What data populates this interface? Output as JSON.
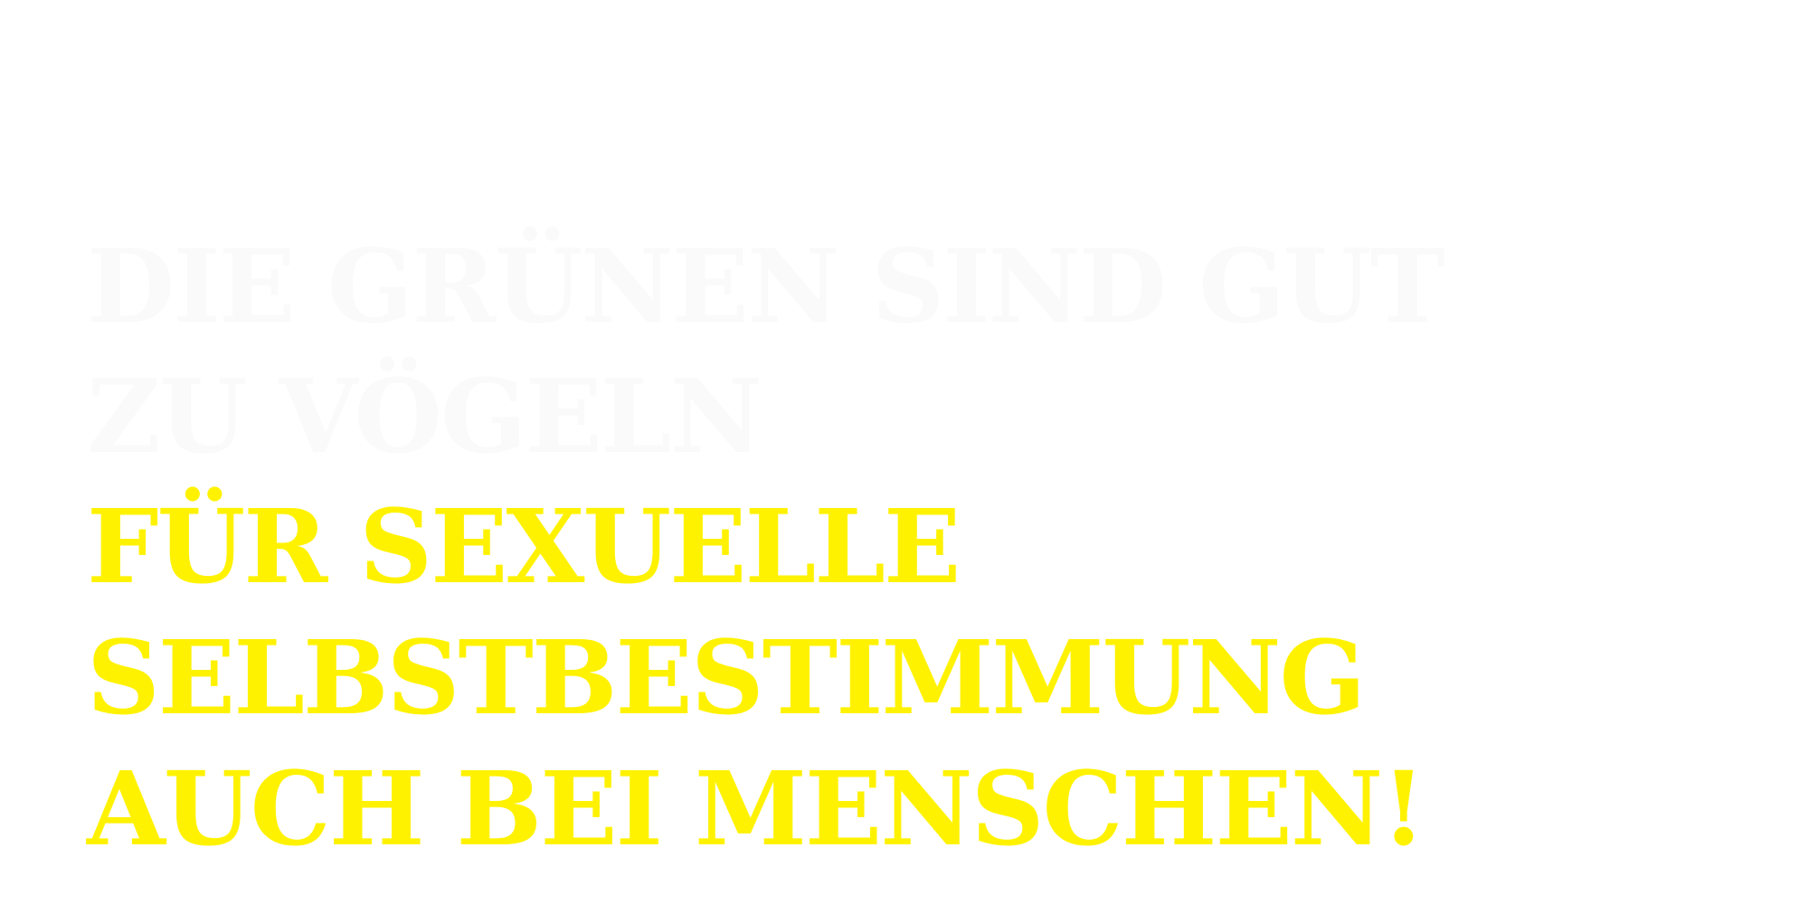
{
  "headline": {
    "ghost_lines": [
      "Die Grünen sind gut",
      "zu Vögeln"
    ],
    "accent_lines": [
      "Für sexuelle",
      "Selbstbestimmung",
      "auch bei Menschen!"
    ]
  },
  "colors": {
    "background": "#ffffff",
    "ghost_text": "#fafafa",
    "accent_text": "#fff200"
  }
}
